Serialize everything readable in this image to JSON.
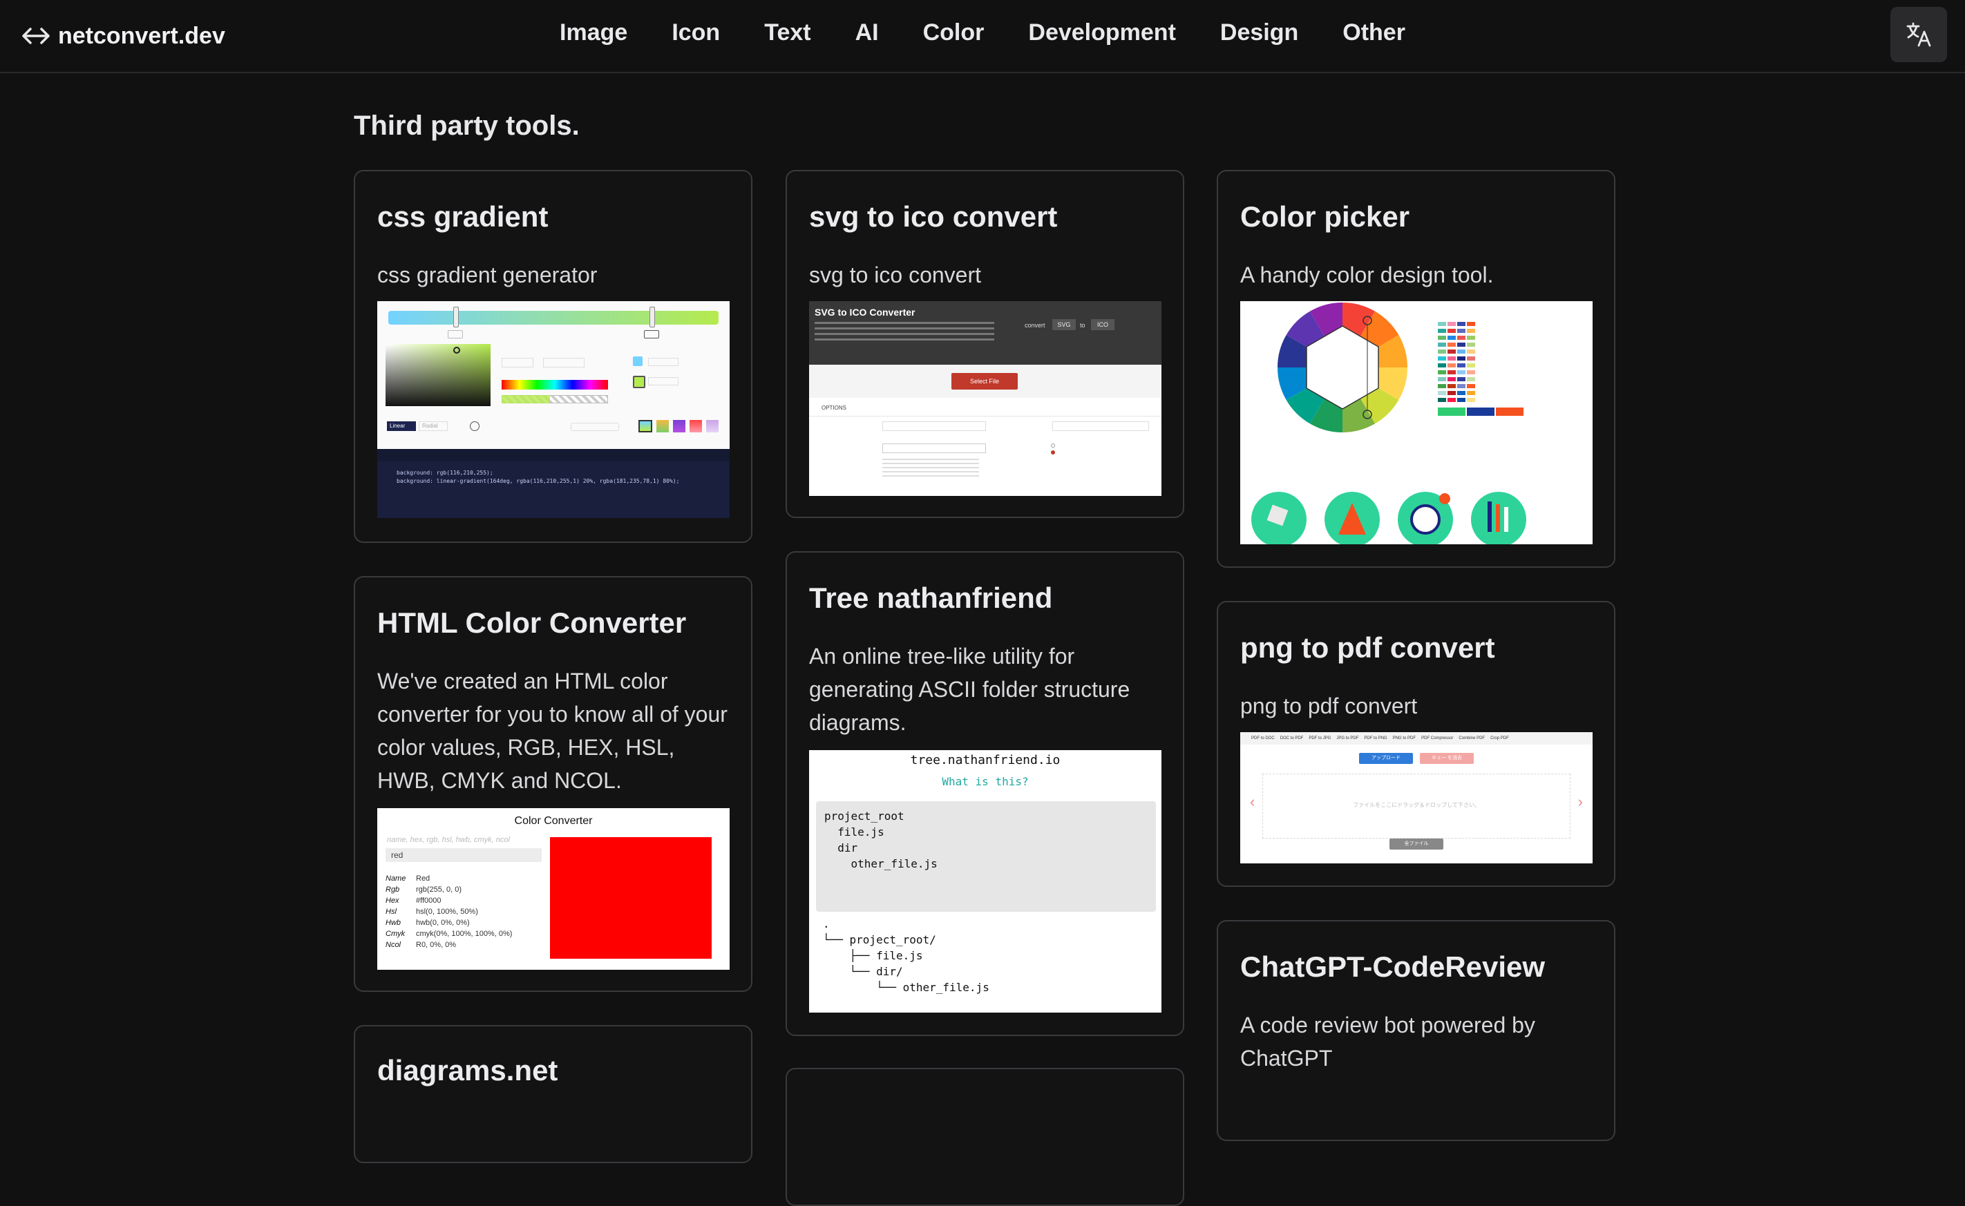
{
  "brand": {
    "name": "netconvert.dev"
  },
  "nav": [
    "Image",
    "Icon",
    "Text",
    "AI",
    "Color",
    "Development",
    "Design",
    "Other"
  ],
  "section": {
    "title": "Third party tools."
  },
  "cards": {
    "css_gradient": {
      "title": "css gradient",
      "desc": "css gradient generator",
      "shot": {
        "linear": "Linear",
        "radial": "Radial",
        "code1": "background: rgb(116,210,255);",
        "code2": "background: linear-gradient(164deg, rgba(116,210,255,1) 20%, rgba(181,235,78,1) 80%);"
      }
    },
    "svg_ico": {
      "title": "svg to ico convert",
      "desc": "svg to ico convert",
      "shot": {
        "heading": "SVG to ICO Converter",
        "convert": "convert",
        "from": "SVG",
        "to_word": "to",
        "to": "ICO",
        "select": "Select File",
        "options": "OPTIONS"
      }
    },
    "color_picker": {
      "title": "Color picker",
      "desc": "A handy color design tool."
    },
    "html_color": {
      "title": "HTML Color Converter",
      "desc": "We've created an HTML color converter for you to know all of your color values, RGB, HEX, HSL, HWB, CMYK and NCOL.",
      "shot": {
        "heading": "Color Converter",
        "placeholder": "name, hex, rgb, hsl, hwb, cmyk, ncol",
        "value": "red",
        "rows": [
          [
            "Name",
            "Red"
          ],
          [
            "Rgb",
            "rgb(255, 0, 0)"
          ],
          [
            "Hex",
            "#ff0000"
          ],
          [
            "Hsl",
            "hsl(0, 100%, 50%)"
          ],
          [
            "Hwb",
            "hwb(0, 0%, 0%)"
          ],
          [
            "Cmyk",
            "cmyk(0%, 100%, 100%, 0%)"
          ],
          [
            "Ncol",
            "R0, 0%, 0%"
          ]
        ],
        "swatch": "#ff0000"
      }
    },
    "tree": {
      "title": "Tree nathanfriend",
      "desc": "An online tree-like utility for generating ASCII folder structure diagrams.",
      "shot": {
        "site": "tree.nathanfriend.io",
        "what": "What is this?",
        "input": [
          "project_root",
          "  file.js",
          "  dir",
          "    other_file.js"
        ],
        "output": [
          ".",
          "└── project_root/",
          "    ├── file.js",
          "    └── dir/",
          "        └── other_file.js"
        ]
      }
    },
    "png_pdf": {
      "title": "png to pdf convert",
      "desc": "png to pdf convert",
      "shot": {
        "tabs": [
          "PDF to DOC",
          "DOC to PDF",
          "PDF to JPG",
          "JPG to PDF",
          "PDF to PNG",
          "PNG to PDF",
          "PDF Compressor",
          "Combine PDF",
          "Crop PDF"
        ],
        "upload": "アップロード",
        "clear": "キュー を消去",
        "drop": "ファイルをここにドラッグ＆ドロップして下さい。",
        "all": "全ファイル"
      }
    },
    "chatgpt": {
      "title": "ChatGPT-CodeReview",
      "desc": "A code review bot powered by ChatGPT"
    },
    "diagrams": {
      "title": "diagrams.net"
    }
  }
}
